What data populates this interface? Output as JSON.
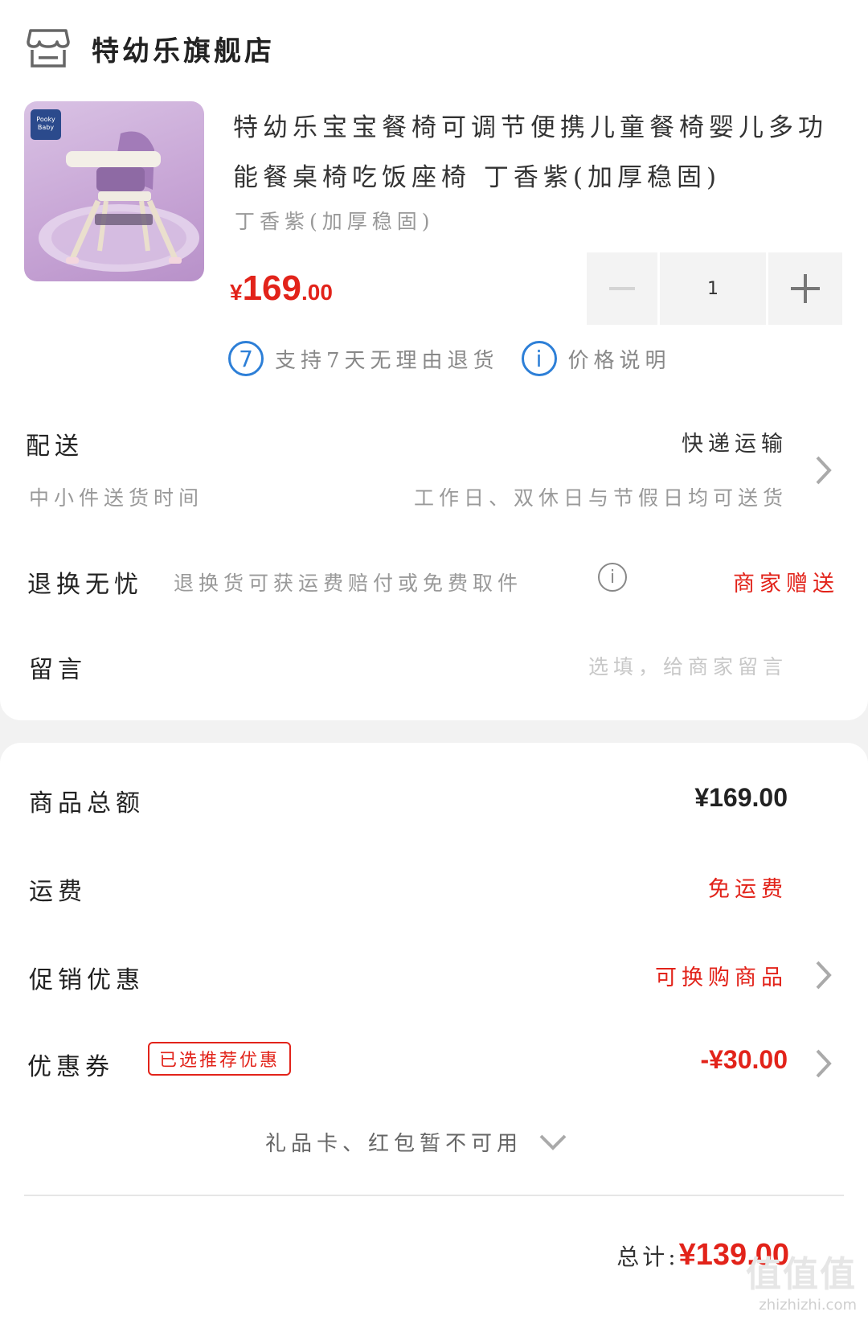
{
  "store": {
    "name": "特幼乐旗舰店",
    "icon": "store-icon"
  },
  "product": {
    "title": "特幼乐宝宝餐椅可调节便携儿童餐椅婴儿多功能餐桌椅吃饭座椅 丁香紫(加厚稳固)",
    "spec": "丁香紫(加厚稳固)",
    "price_symbol": "¥",
    "price_int": "169",
    "price_dec": ".00",
    "quantity": "1",
    "image_logo_text": "Pooky Baby"
  },
  "badges": [
    {
      "icon": "7",
      "label": "支持7天无理由退货"
    },
    {
      "icon": "i",
      "label": "价格说明"
    }
  ],
  "delivery": {
    "label": "配送",
    "method": "快递运输",
    "sub_label": "中小件送货时间",
    "sub_value": "工作日、双休日与节假日均可送货"
  },
  "returns": {
    "label": "退换无忧",
    "desc": "退换货可获运费赔付或免费取件",
    "value": "商家赠送"
  },
  "message": {
    "label": "留言",
    "placeholder": "选填，给商家留言"
  },
  "summary": {
    "goods_total_label": "商品总额",
    "goods_total_value": "¥169.00",
    "shipping_label": "运费",
    "shipping_value": "免运费",
    "promo_label": "促销优惠",
    "promo_value": "可换购商品",
    "coupon_label": "优惠券",
    "coupon_tag": "已选推荐优惠",
    "coupon_value": "-¥30.00",
    "gift_text": "礼品卡、红包暂不可用",
    "total_label": "总计:",
    "total_value": "¥139.00"
  },
  "watermark": {
    "mark": "值值值",
    "site": "zhizhizhi.com"
  },
  "colors": {
    "accent": "#e2231a",
    "badge_blue": "#2d7fd7",
    "muted": "#999999"
  }
}
